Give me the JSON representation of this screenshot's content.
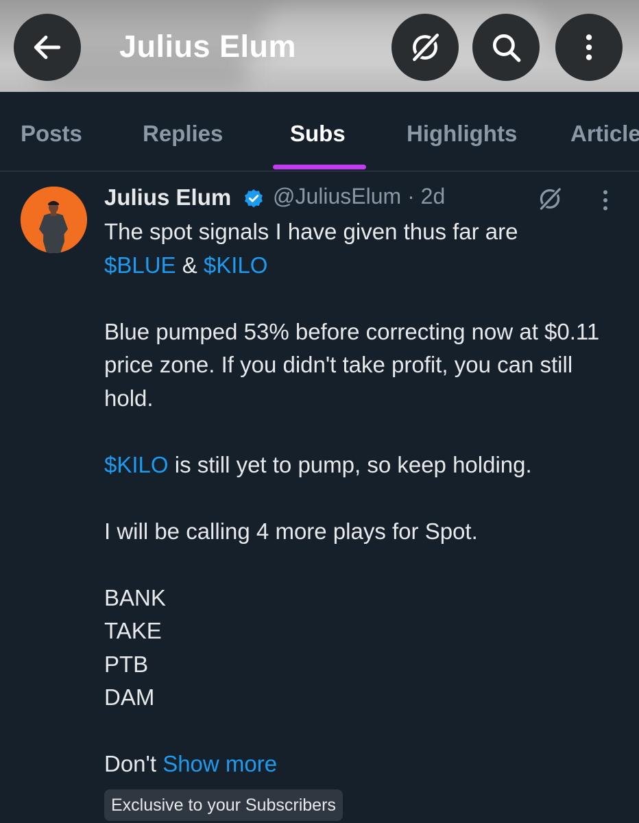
{
  "header": {
    "title": "Julius Elum",
    "back_icon": "arrow-left-icon",
    "grok_icon": "grok-icon",
    "search_icon": "search-icon",
    "more_icon": "more-vertical-icon"
  },
  "tabs": [
    {
      "label": "Posts",
      "active": false
    },
    {
      "label": "Replies",
      "active": false
    },
    {
      "label": "Subs",
      "active": true
    },
    {
      "label": "Highlights",
      "active": false
    },
    {
      "label": "Articles",
      "active": false
    }
  ],
  "post": {
    "author": "Julius Elum",
    "handle": "@JuliusElum · 2d",
    "line1": "The spot signals I have given thus far are",
    "tag_blue": "$BLUE",
    "amp": " & ",
    "tag_kilo": "$KILO",
    "para2": "Blue pumped 53% before correcting now at $0.11 price zone. If you didn't take profit, you can still hold.",
    "para3_tag": "$KILO",
    "para3_rest": " is still yet to pump, so keep holding.",
    "para4": "I will be calling 4 more plays for Spot.",
    "tickers": [
      "BANK",
      "TAKE",
      "PTB",
      "DAM"
    ],
    "final_text": "Don't ",
    "show_more": "Show more",
    "exclusive_badge": "Exclusive to your Subscribers"
  },
  "colors": {
    "background": "#15202b",
    "link": "#1d9bf0",
    "tab_indicator": "#c13cf1",
    "avatar_bg": "#f26f21"
  }
}
